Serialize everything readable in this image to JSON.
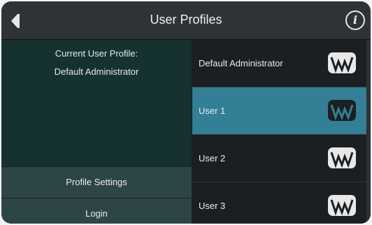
{
  "header": {
    "title": "User Profiles",
    "back_icon": "back-arrow-icon",
    "info_icon": "info-icon",
    "info_glyph": "i"
  },
  "current_profile": {
    "label": "Current User Profile:",
    "name": "Default Administrator"
  },
  "buttons": {
    "profile_settings": "Profile Settings",
    "login": "Login"
  },
  "profiles": [
    {
      "label": "Default Administrator",
      "selected": false
    },
    {
      "label": "User 1",
      "selected": true
    },
    {
      "label": "User 2",
      "selected": false
    },
    {
      "label": "User 3",
      "selected": false
    }
  ],
  "colors": {
    "background": "#1b1f21",
    "titlebar": "#2f3336",
    "left_panel": "#153231",
    "side_button": "#2e4547",
    "selected_item": "#337f96",
    "text": "#f0f0f0"
  }
}
